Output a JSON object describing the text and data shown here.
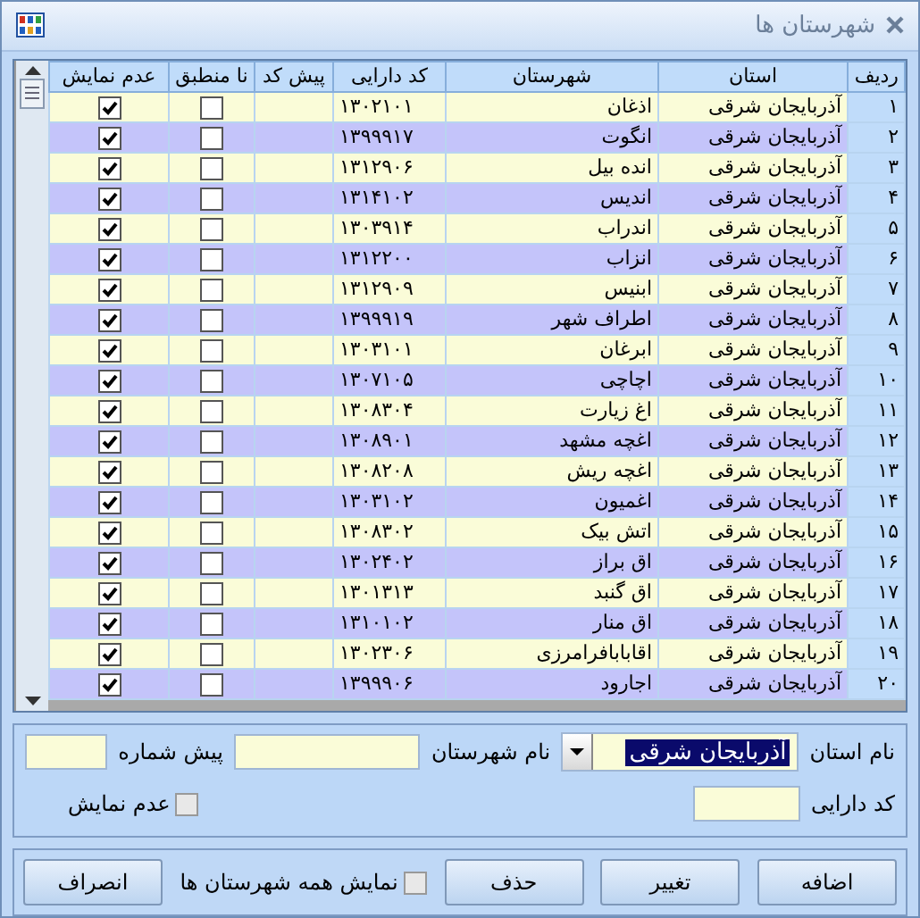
{
  "window": {
    "title": "شهرستان ها"
  },
  "table": {
    "columns": [
      "ردیف",
      "استان",
      "شهرستان",
      "کد دارایی",
      "پیش کد",
      "نا منطبق",
      "عدم نمایش"
    ],
    "rows": [
      {
        "row": "۱",
        "province": "آذربایجان شرقی",
        "city": "اذغان",
        "code": "۱۳۰۲۱۰۱",
        "mismatch": false,
        "hidden": true
      },
      {
        "row": "۲",
        "province": "آذربایجان شرقی",
        "city": "انگوت",
        "code": "۱۳۹۹۹۱۷",
        "mismatch": false,
        "hidden": true
      },
      {
        "row": "۳",
        "province": "آذربایجان شرقی",
        "city": "انده  بیل",
        "code": "۱۳۱۲۹۰۶",
        "mismatch": false,
        "hidden": true
      },
      {
        "row": "۴",
        "province": "آذربایجان شرقی",
        "city": "اندیس",
        "code": "۱۳۱۴۱۰۲",
        "mismatch": false,
        "hidden": true
      },
      {
        "row": "۵",
        "province": "آذربایجان شرقی",
        "city": "اندراب",
        "code": "۱۳۰۳۹۱۴",
        "mismatch": false,
        "hidden": true
      },
      {
        "row": "۶",
        "province": "آذربایجان شرقی",
        "city": "انزاب",
        "code": "۱۳۱۲۲۰۰",
        "mismatch": false,
        "hidden": true
      },
      {
        "row": "۷",
        "province": "آذربایجان شرقی",
        "city": "ابنیس",
        "code": "۱۳۱۲۹۰۹",
        "mismatch": false,
        "hidden": true
      },
      {
        "row": "۸",
        "province": "آذربایجان شرقی",
        "city": "اطراف شهر",
        "code": "۱۳۹۹۹۱۹",
        "mismatch": false,
        "hidden": true
      },
      {
        "row": "۹",
        "province": "آذربایجان شرقی",
        "city": "ابرغان",
        "code": "۱۳۰۳۱۰۱",
        "mismatch": false,
        "hidden": true
      },
      {
        "row": "۱۰",
        "province": "آذربایجان شرقی",
        "city": "اچاچی",
        "code": "۱۳۰۷۱۰۵",
        "mismatch": false,
        "hidden": true
      },
      {
        "row": "۱۱",
        "province": "آذربایجان شرقی",
        "city": "اغ  زیارت",
        "code": "۱۳۰۸۳۰۴",
        "mismatch": false,
        "hidden": true
      },
      {
        "row": "۱۲",
        "province": "آذربایجان شرقی",
        "city": "اغچه  مشهد",
        "code": "۱۳۰۸۹۰۱",
        "mismatch": false,
        "hidden": true
      },
      {
        "row": "۱۳",
        "province": "آذربایجان شرقی",
        "city": "اغچه  ریش",
        "code": "۱۳۰۸۲۰۸",
        "mismatch": false,
        "hidden": true
      },
      {
        "row": "۱۴",
        "province": "آذربایجان شرقی",
        "city": "اغمیون",
        "code": "۱۳۰۳۱۰۲",
        "mismatch": false,
        "hidden": true
      },
      {
        "row": "۱۵",
        "province": "آذربایجان شرقی",
        "city": "اتش بیک",
        "code": "۱۳۰۸۳۰۲",
        "mismatch": false,
        "hidden": true
      },
      {
        "row": "۱۶",
        "province": "آذربایجان شرقی",
        "city": "اق  براز",
        "code": "۱۳۰۲۴۰۲",
        "mismatch": false,
        "hidden": true
      },
      {
        "row": "۱۷",
        "province": "آذربایجان شرقی",
        "city": "اق  گنبد",
        "code": "۱۳۰۱۳۱۳",
        "mismatch": false,
        "hidden": true
      },
      {
        "row": "۱۸",
        "province": "آذربایجان شرقی",
        "city": "اق  منار",
        "code": "۱۳۱۰۱۰۲",
        "mismatch": false,
        "hidden": true
      },
      {
        "row": "۱۹",
        "province": "آذربایجان شرقی",
        "city": "اقابابافرامرزی",
        "code": "۱۳۰۲۳۰۶",
        "mismatch": false,
        "hidden": true
      },
      {
        "row": "۲۰",
        "province": "آذربایجان شرقی",
        "city": "اجارود",
        "code": "۱۳۹۹۹۰۶",
        "mismatch": false,
        "hidden": true
      }
    ]
  },
  "form": {
    "province_label": "نام استان",
    "province_value": "آذربایجان شرقی",
    "province_highlighted": true,
    "city_label": "نام شهرستان",
    "prefix_label": "پیش شماره",
    "asset_code_label": "کد دارایی",
    "hide": {
      "label": "عدم نمایش",
      "checked": false
    }
  },
  "footer": [
    {
      "kind": "button",
      "label": "اضافه"
    },
    {
      "kind": "button",
      "label": "تغییر"
    },
    {
      "kind": "button",
      "label": "حذف"
    },
    {
      "kind": "checkbox",
      "label": "نمایش همه شهرستان ها",
      "checked": false
    },
    {
      "kind": "button",
      "label": "انصراف"
    }
  ]
}
